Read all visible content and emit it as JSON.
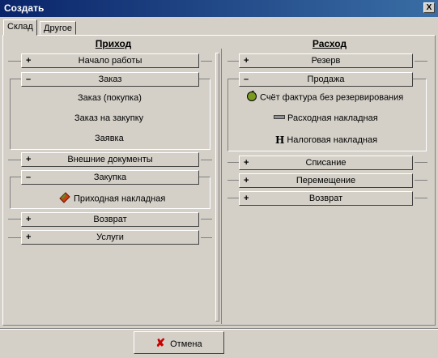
{
  "window": {
    "title": "Создать",
    "close_label": "X"
  },
  "tabs": [
    {
      "label": "Склад"
    },
    {
      "label": "Другое"
    }
  ],
  "left": {
    "heading": "Приход",
    "sections": {
      "start": {
        "sign": "+",
        "label": "Начало работы"
      },
      "order": {
        "sign": "–",
        "label": "Заказ",
        "items": [
          "Заказ (покупка)",
          "Заказ на закупку",
          "Заявка"
        ]
      },
      "external": {
        "sign": "+",
        "label": "Внешние документы"
      },
      "purchase": {
        "sign": "–",
        "label": "Закупка",
        "items": [
          "Приходная накладная"
        ]
      },
      "return": {
        "sign": "+",
        "label": "Возврат"
      },
      "services": {
        "sign": "+",
        "label": "Услуги"
      }
    }
  },
  "right": {
    "heading": "Расход",
    "sections": {
      "reserve": {
        "sign": "+",
        "label": "Резерв"
      },
      "sale": {
        "sign": "–",
        "label": "Продажа",
        "items": [
          "Счёт фактура без резервирования",
          "Расходная накладная",
          "Налоговая накладная"
        ]
      },
      "writeoff": {
        "sign": "+",
        "label": "Списание"
      },
      "move": {
        "sign": "+",
        "label": "Перемещение"
      },
      "return": {
        "sign": "+",
        "label": "Возврат"
      }
    }
  },
  "footer": {
    "cancel_label": "Отмена"
  },
  "icons": [
    "receipt-icon",
    "invoice-icon",
    "expense-icon",
    "tax-icon",
    "cancel-icon"
  ]
}
